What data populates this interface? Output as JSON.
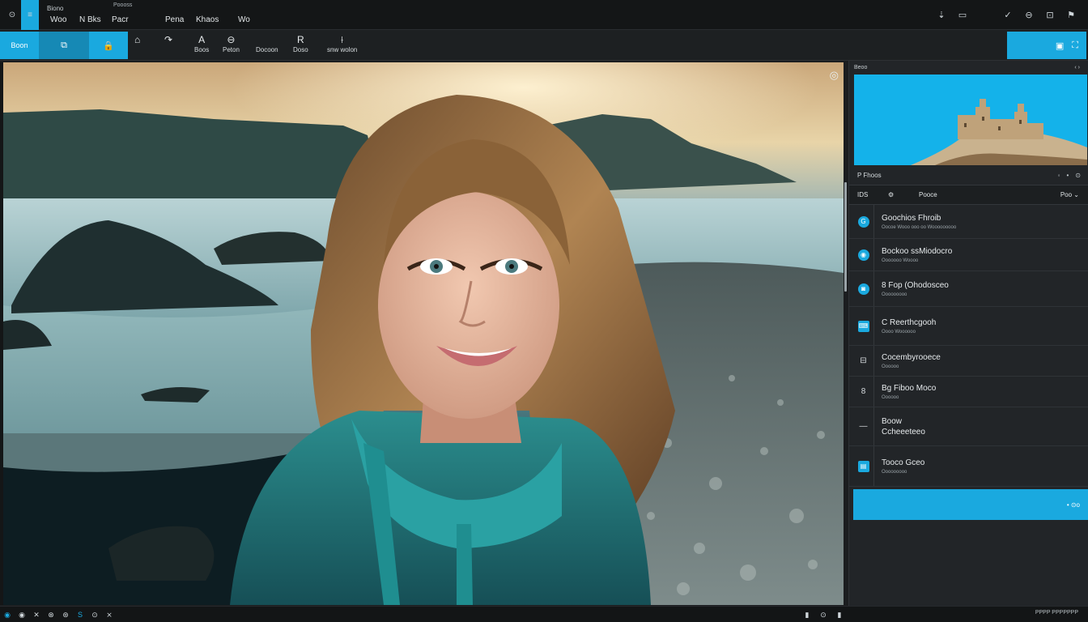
{
  "menubar": {
    "active_tile_icon": "≡",
    "left_icon": "⊙",
    "stack_lines": [
      "Biono",
      "Woo"
    ],
    "tab_top": "Poooss",
    "items": [
      "N Bks",
      "Pacr",
      "Pena",
      "Khaos",
      "Wo"
    ],
    "right_icons": [
      "⇣",
      "▭",
      "✓",
      "⊖",
      "⊡",
      "⚑"
    ]
  },
  "toolbar": {
    "home_label": "Boon",
    "tile2_icon": "⧉",
    "tile3_icon": "🔒",
    "tools": [
      {
        "glyph": "⌂",
        "label": ""
      },
      {
        "glyph": "↷",
        "label": ""
      },
      {
        "glyph": "A",
        "label": "Boos"
      },
      {
        "glyph": "⊖",
        "label": "Peton"
      },
      {
        "glyph": "",
        "label": "Docoon"
      },
      {
        "glyph": "R",
        "label": "Doso"
      },
      {
        "glyph": "⟊",
        "label": "snw wolon"
      }
    ],
    "right_icons": [
      "▣",
      "⛶"
    ]
  },
  "canvas": {
    "corner_icon": "◎",
    "image_subject": "portrait"
  },
  "panel": {
    "header_title": "Beoo",
    "header_icons": [
      "‹",
      "›"
    ],
    "layers_title": "P Fhoos",
    "layers_ctrls": [
      "◦",
      "•",
      "⊙"
    ],
    "col_a": "IDS",
    "col_b": "⚙",
    "col_c": "Pooce",
    "col_d": "Poo ⌄",
    "layers": [
      {
        "icon": "G",
        "icon_style": "round",
        "name": "Goochios Fhroib",
        "sub": "Oocoe Wooo ooo oo Wooooooooo"
      },
      {
        "icon": "◉",
        "icon_style": "round",
        "name": "Bockoo ssMiodocro",
        "sub": "Ooooooo Woooo"
      },
      {
        "icon": "◙",
        "icon_style": "round",
        "name": "8 Fop (Ohodosceo",
        "sub": "Ooooooooo"
      },
      {
        "icon": "⌨",
        "icon_style": "sq",
        "name": "C Reerthcgooh",
        "sub": "Oooo Woooooo"
      },
      {
        "icon": "⊟",
        "icon_style": "plain",
        "name": "Cocembyrooece",
        "sub": "Oooooo"
      },
      {
        "icon": "8",
        "icon_style": "plain",
        "name": "Bg Fiboo Moco",
        "sub": "Oooooo"
      },
      {
        "icon": "—",
        "icon_style": "plain",
        "name": "Boow\nCcheeeteeo",
        "sub": ""
      },
      {
        "icon": "▤",
        "icon_style": "sq",
        "name": "Tooco Gceo",
        "sub": "Ooooooooo"
      }
    ],
    "action_label": "• ⊙o"
  },
  "statusbar": {
    "left_icons": [
      "◉",
      "◉",
      "✕",
      "⊗",
      "⊛",
      "S",
      "⊙",
      "⨯"
    ],
    "mid_icons": [
      "▮",
      "⊙",
      "▮"
    ],
    "right_text": "PPPP PPPPPPP"
  },
  "colors": {
    "accent": "#1aa9df",
    "panel_bg": "#222528",
    "chrome_bg": "#141617"
  }
}
